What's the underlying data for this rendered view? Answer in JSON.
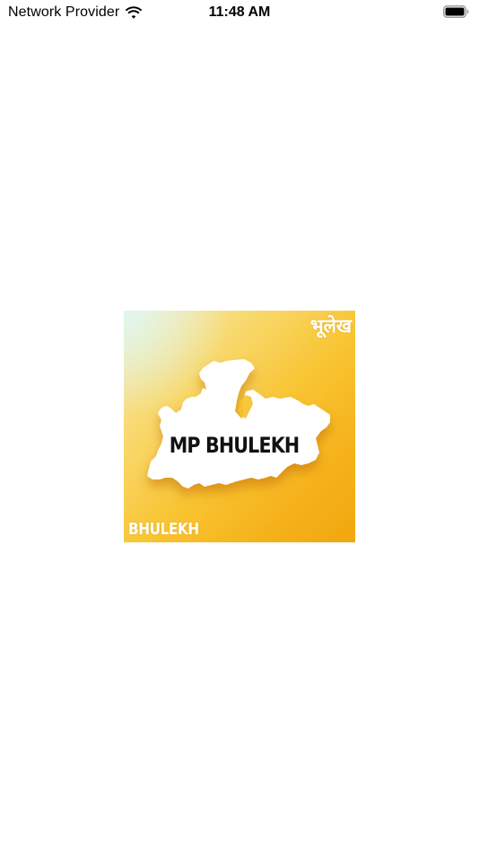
{
  "status_bar": {
    "carrier": "Network Provider",
    "time": "11:48 AM",
    "wifi_icon": "wifi-icon",
    "battery_icon": "battery-full-icon"
  },
  "splash": {
    "logo_title": "MP BHULEKH",
    "logo_hindi": "भूलेख",
    "logo_brand": "BHULEKH",
    "colors": {
      "background": "#ffffff",
      "logo_gradient_start": "#f6ecc0",
      "logo_gradient_end": "#f2a70f",
      "map_fill": "#ffffff",
      "title_text": "#111111"
    }
  }
}
